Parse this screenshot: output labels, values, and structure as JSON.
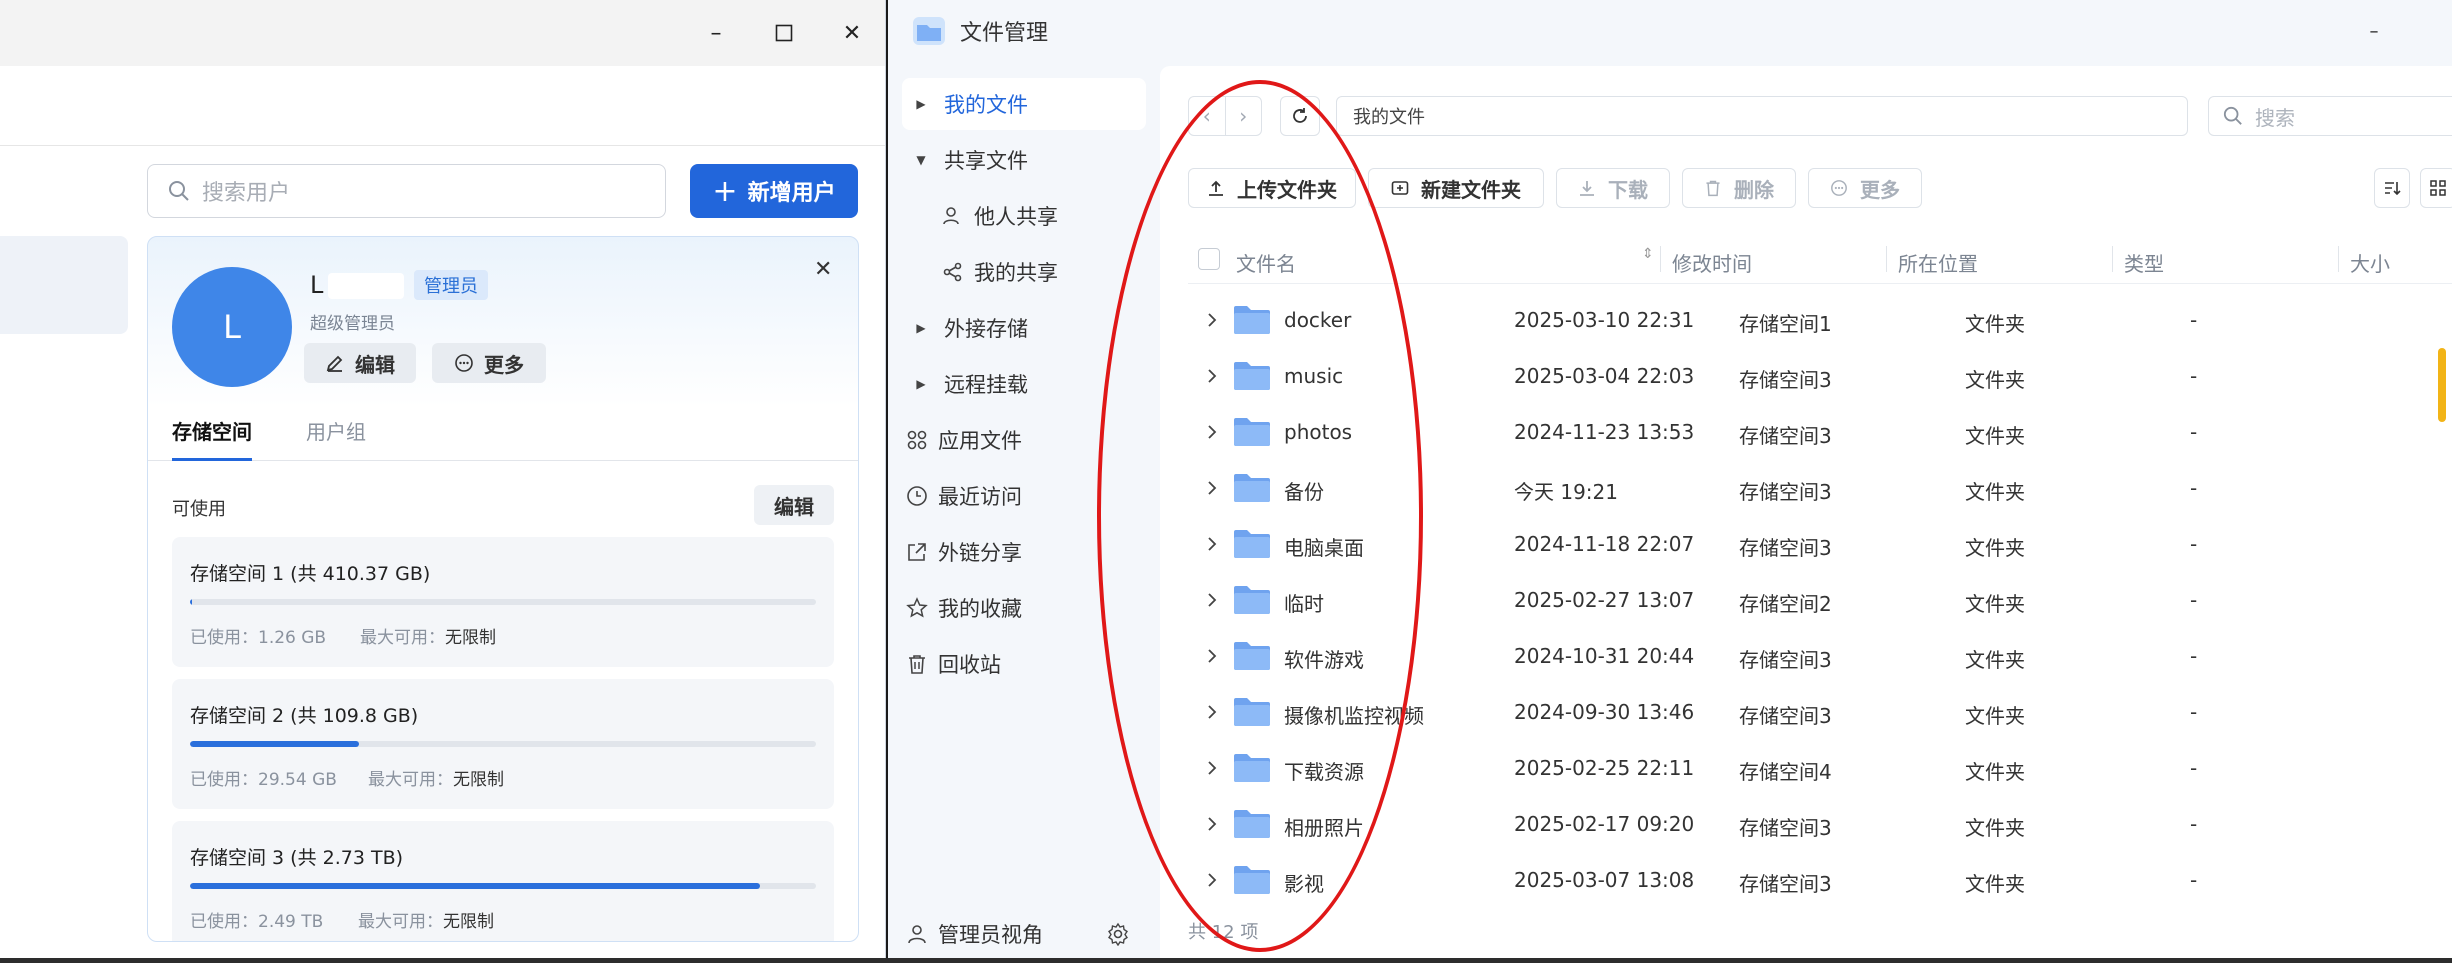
{
  "left_window": {
    "search_placeholder": "搜索用户",
    "add_user_label": "新增用户",
    "user": {
      "avatar_letter": "L",
      "name": "L",
      "role_badge": "管理员",
      "role_sub": "超级管理员",
      "edit_label": "编辑",
      "more_label": "更多"
    },
    "tabs": [
      "存储空间",
      "用户组"
    ],
    "available_label": "可使用",
    "edit_label": "编辑",
    "storages": [
      {
        "title": "存储空间 1 (共 410.37 GB)",
        "used": "已使用：1.26 GB",
        "max_label": "最大可用：",
        "max_value": "无限制",
        "fill": 0.003
      },
      {
        "title": "存储空间 2 (共 109.8 GB)",
        "used": "已使用：29.54 GB",
        "max_label": "最大可用：",
        "max_value": "无限制",
        "fill": 0.27
      },
      {
        "title": "存储空间 3 (共 2.73 TB)",
        "used": "已使用：2.49 TB",
        "max_label": "最大可用：",
        "max_value": "无限制",
        "fill": 0.91
      }
    ]
  },
  "file_manager": {
    "title": "文件管理",
    "sidebar": {
      "my_files": "我的文件",
      "shared_files": "共享文件",
      "shared_by_others": "他人共享",
      "my_shares": "我的共享",
      "external_storage": "外接存储",
      "remote_mount": "远程挂载",
      "app_files": "应用文件",
      "recent": "最近访问",
      "link_share": "外链分享",
      "favorites": "我的收藏",
      "recycle_bin": "回收站",
      "admin_view": "管理员视角"
    },
    "path": "我的文件",
    "search_placeholder": "搜索",
    "actions": {
      "upload_folder": "上传文件夹",
      "new_folder": "新建文件夹",
      "download": "下载",
      "delete": "删除",
      "more": "更多"
    },
    "columns": {
      "name": "文件名",
      "modified": "修改时间",
      "location": "所在位置",
      "type": "类型",
      "size": "大小"
    },
    "files": [
      {
        "name": "docker",
        "modified": "2025-03-10 22:31",
        "location": "存储空间1",
        "type": "文件夹",
        "size": "-"
      },
      {
        "name": "music",
        "modified": "2025-03-04 22:03",
        "location": "存储空间3",
        "type": "文件夹",
        "size": "-"
      },
      {
        "name": "photos",
        "modified": "2024-11-23 13:53",
        "location": "存储空间3",
        "type": "文件夹",
        "size": "-"
      },
      {
        "name": "备份",
        "modified": "今天 19:21",
        "location": "存储空间3",
        "type": "文件夹",
        "size": "-"
      },
      {
        "name": "电脑桌面",
        "modified": "2024-11-18 22:07",
        "location": "存储空间3",
        "type": "文件夹",
        "size": "-"
      },
      {
        "name": "临时",
        "modified": "2025-02-27 13:07",
        "location": "存储空间2",
        "type": "文件夹",
        "size": "-"
      },
      {
        "name": "软件游戏",
        "modified": "2024-10-31 20:44",
        "location": "存储空间3",
        "type": "文件夹",
        "size": "-"
      },
      {
        "name": "摄像机监控视频",
        "modified": "2024-09-30 13:46",
        "location": "存储空间3",
        "type": "文件夹",
        "size": "-"
      },
      {
        "name": "下载资源",
        "modified": "2025-02-25 22:11",
        "location": "存储空间4",
        "type": "文件夹",
        "size": "-"
      },
      {
        "name": "相册照片",
        "modified": "2025-02-17 09:20",
        "location": "存储空间3",
        "type": "文件夹",
        "size": "-"
      },
      {
        "name": "影视",
        "modified": "2025-03-07 13:08",
        "location": "存储空间3",
        "type": "文件夹",
        "size": "-"
      }
    ],
    "footer": "共 12 项"
  },
  "colors": {
    "accent": "#2266db",
    "annotation": "#e01818",
    "folder": "#7fb0f5"
  }
}
